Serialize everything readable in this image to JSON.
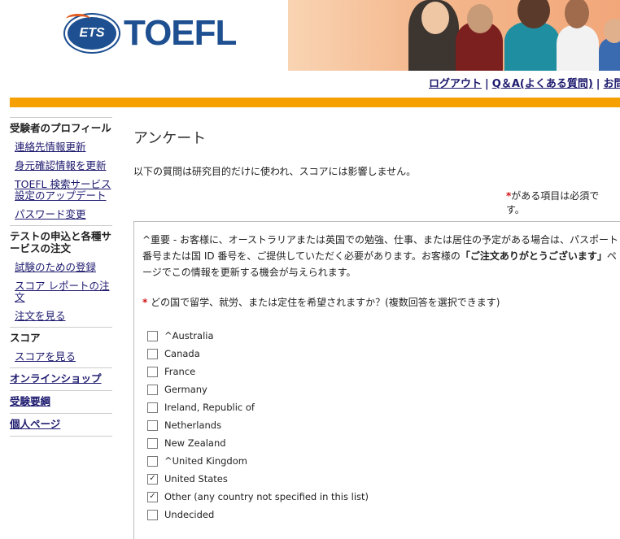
{
  "header": {
    "ets_logo": "ETS",
    "toefl_logo": "TOEFL",
    "links": [
      "ログアウト",
      "Q＆A(よくある質問)",
      "お問"
    ],
    "separator": "|"
  },
  "sidebar": {
    "sections": [
      {
        "title": "受験者のプロフィール",
        "links": [
          "連絡先情報更新",
          "身元確認情報を更新",
          "TOEFL 検索サービス設定のアップデート",
          "パスワード変更"
        ]
      },
      {
        "title": "テストの申込と各種サービスの注文",
        "links": [
          "試験のための登録",
          "スコア レポートの注文",
          "注文を見る"
        ]
      },
      {
        "title": "スコア",
        "links": [
          "スコアを見る"
        ]
      }
    ],
    "solo_links": [
      "オンラインショップ",
      "受験要綱",
      "個人ページ"
    ]
  },
  "main": {
    "title": "アンケート",
    "intro": "以下の質問は研究目的だけに使われ、スコアには影響しません。",
    "required_star": "*",
    "required_note": "がある項目は必須です。",
    "notice_part1": "^重要 - お客様に、オーストラリアまたは英国での勉強、仕事、または居住の予定がある場合は、パスポート番号または国 ID 番号を、ご提供していただく必要があります。お客様の",
    "notice_bold": "「ご注文ありがとうございます」",
    "notice_part2": "ページでこの情報を更新する機会が与えられます。",
    "question": "どの国で留学、就労、または定住を希望されますか？(複数回答を選択できます)",
    "options": [
      {
        "label": "^Australia",
        "checked": false
      },
      {
        "label": "Canada",
        "checked": false
      },
      {
        "label": "France",
        "checked": false
      },
      {
        "label": "Germany",
        "checked": false
      },
      {
        "label": "Ireland, Republic of",
        "checked": false
      },
      {
        "label": "Netherlands",
        "checked": false
      },
      {
        "label": "New Zealand",
        "checked": false
      },
      {
        "label": "^United Kingdom",
        "checked": false
      },
      {
        "label": "United States",
        "checked": true
      },
      {
        "label": "Other (any country not specified in this list)",
        "checked": true
      },
      {
        "label": "Undecided",
        "checked": false
      }
    ],
    "check_glyph": "✓"
  },
  "colors": {
    "accent_bar": "#f6a000",
    "link": "#1d1a6e",
    "brand": "#1d4f91",
    "required": "#d01010"
  }
}
